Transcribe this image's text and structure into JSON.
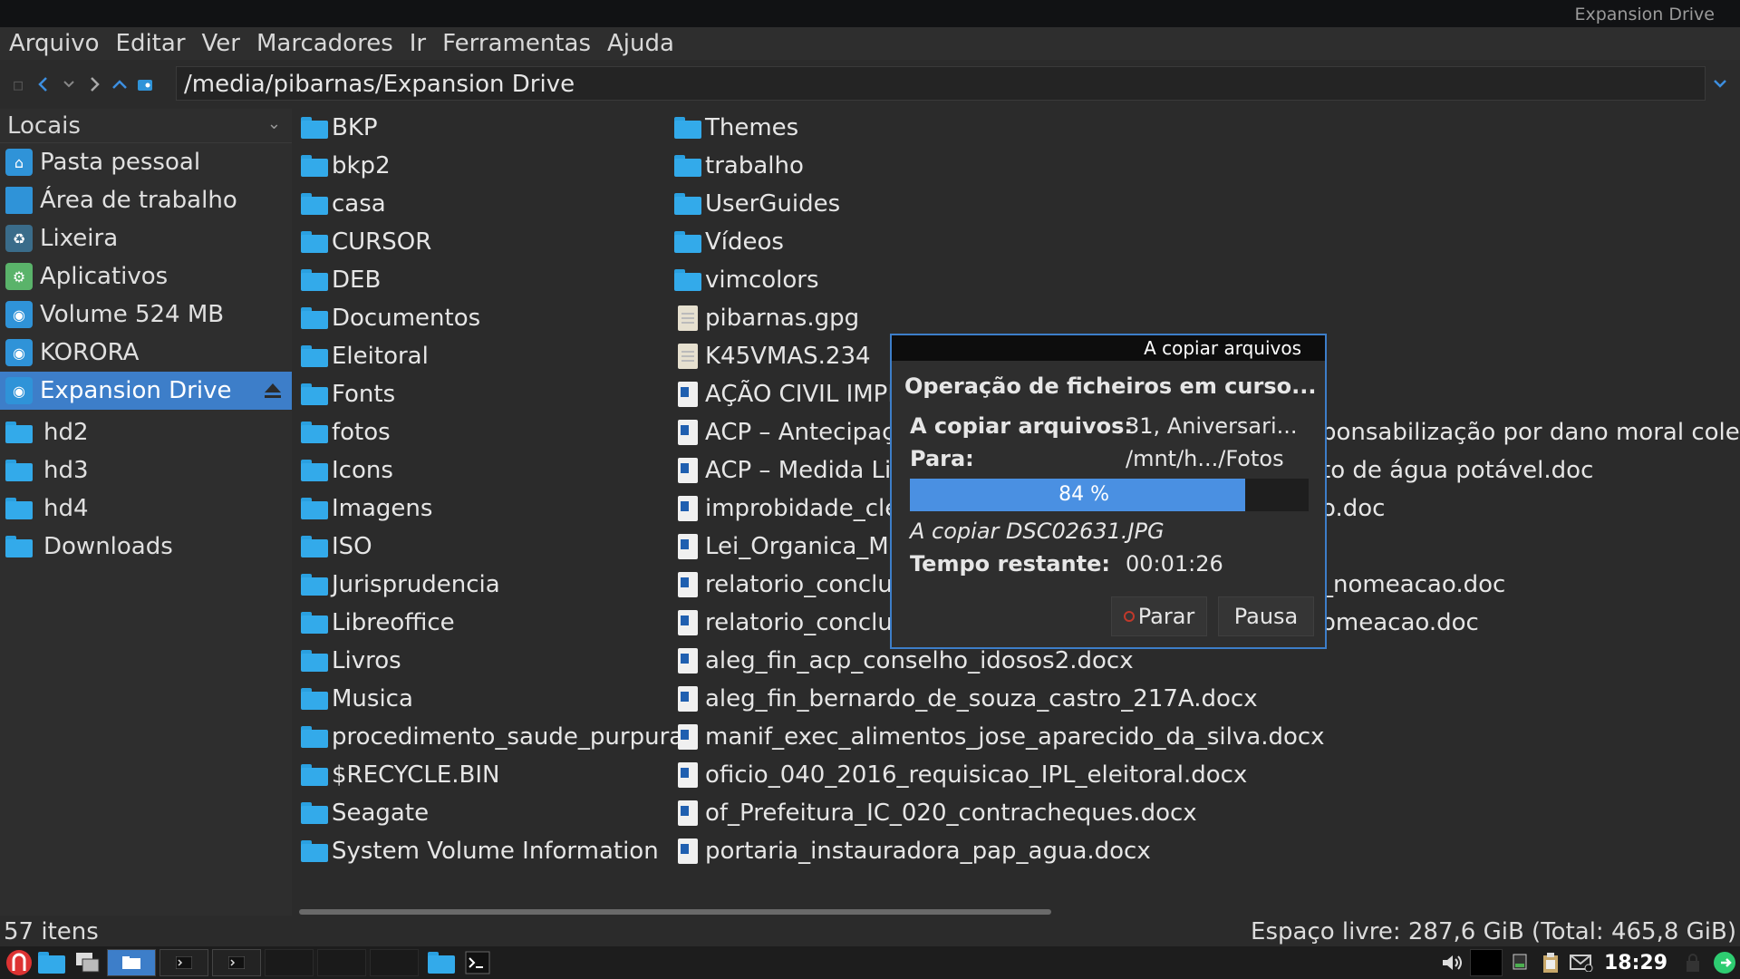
{
  "window": {
    "title": "Expansion Drive"
  },
  "menu": [
    "Arquivo",
    "Editar",
    "Ver",
    "Marcadores",
    "Ir",
    "Ferramentas",
    "Ajuda"
  ],
  "toolbar": {
    "path": "/media/pibarnas/Expansion Drive"
  },
  "sidebar": {
    "header": "Locais",
    "items": [
      {
        "label": "Pasta pessoal",
        "icon": "home-icon"
      },
      {
        "label": "Área de trabalho",
        "icon": "desktop-icon"
      },
      {
        "label": "Lixeira",
        "icon": "trash-icon"
      },
      {
        "label": "Aplicativos",
        "icon": "applications-icon"
      },
      {
        "label": "Volume 524 MB",
        "icon": "drive-icon"
      },
      {
        "label": "KORORA",
        "icon": "drive-icon"
      },
      {
        "label": "Expansion Drive",
        "icon": "drive-icon",
        "selected": true
      }
    ],
    "bookmarks": [
      "hd2",
      "hd3",
      "hd4",
      "Downloads"
    ]
  },
  "files": {
    "col1": [
      "BKP",
      "bkp2",
      "casa",
      "CURSOR",
      "DEB",
      "Documentos",
      "Eleitoral",
      "Fonts",
      "fotos",
      "Icons",
      "Imagens",
      "ISO",
      "Jurisprudencia",
      "Libreoffice",
      "Livros",
      "Musica",
      "procedimento_saude_purpura",
      "$RECYCLE.BIN",
      "Seagate",
      "System Volume Information"
    ],
    "col2": [
      {
        "name": "Themes",
        "type": "folder"
      },
      {
        "name": "trabalho",
        "type": "folder"
      },
      {
        "name": "UserGuides",
        "type": "folder"
      },
      {
        "name": "Vídeos",
        "type": "folder"
      },
      {
        "name": "vimcolors",
        "type": "folder"
      },
      {
        "name": "pibarnas.gpg",
        "type": "plain"
      },
      {
        "name": "K45VMAS.234",
        "type": "plain"
      },
      {
        "name": "AÇÃO CIVIL IMPI",
        "type": "word"
      },
      {
        "name": "ACP – Antecipaç",
        "type": "word"
      },
      {
        "name": "ACP – Medida Lir",
        "type": "word"
      },
      {
        "name": "improbidade_cle",
        "type": "word"
      },
      {
        "name": "Lei_Organica_MI",
        "type": "word"
      },
      {
        "name": "relatorio_conclu",
        "type": "word"
      },
      {
        "name": "relatorio_conclu",
        "type": "word"
      },
      {
        "name": "aleg_fin_acp_conselho_idosos2.docx",
        "type": "word"
      },
      {
        "name": "aleg_fin_bernardo_de_souza_castro_217A.docx",
        "type": "word"
      },
      {
        "name": "manif_exec_alimentos_jose_aparecido_da_silva.docx",
        "type": "word"
      },
      {
        "name": "oficio_040_2016_requisicao_IPL_eleitoral.docx",
        "type": "word"
      },
      {
        "name": "of_Prefeitura_IC_020_contracheques.docx",
        "type": "word"
      },
      {
        "name": "portaria_instauradora_pap_agua.docx",
        "type": "word"
      }
    ],
    "overflow": [
      {
        "row": 8,
        "text": "ponsabilização por dano moral coletiv"
      },
      {
        "row": 9,
        "text": "to de água potável.doc"
      },
      {
        "row": 10,
        "text": "o.doc"
      },
      {
        "row": 12,
        "text": "_nomeacao.doc"
      },
      {
        "row": 13,
        "text": "omeacao.doc"
      }
    ]
  },
  "status": {
    "items": "57 itens",
    "free_space": "Espaço livre: 287,6 GiB (Total: 465,8 GiB)"
  },
  "dialog": {
    "title": "A copiar arquivos",
    "heading": "Operação de ficheiros em curso...",
    "copying_label": "A copiar arquivos:",
    "copying_value": "31, Aniversari...",
    "to_label": "Para:",
    "to_value": "/mnt/h.../Fotos",
    "progress_percent": 84,
    "progress_text": "84 %",
    "current_file": "A copiar DSC02631.JPG",
    "remaining_label": "Tempo restante:",
    "remaining_value": "00:01:26",
    "stop_label": "Parar",
    "pause_label": "Pausa"
  },
  "taskbar": {
    "clock": "18:29"
  },
  "colors": {
    "accent": "#3d7ec9",
    "folder": "#33aaea",
    "progress": "#4a90e2"
  }
}
